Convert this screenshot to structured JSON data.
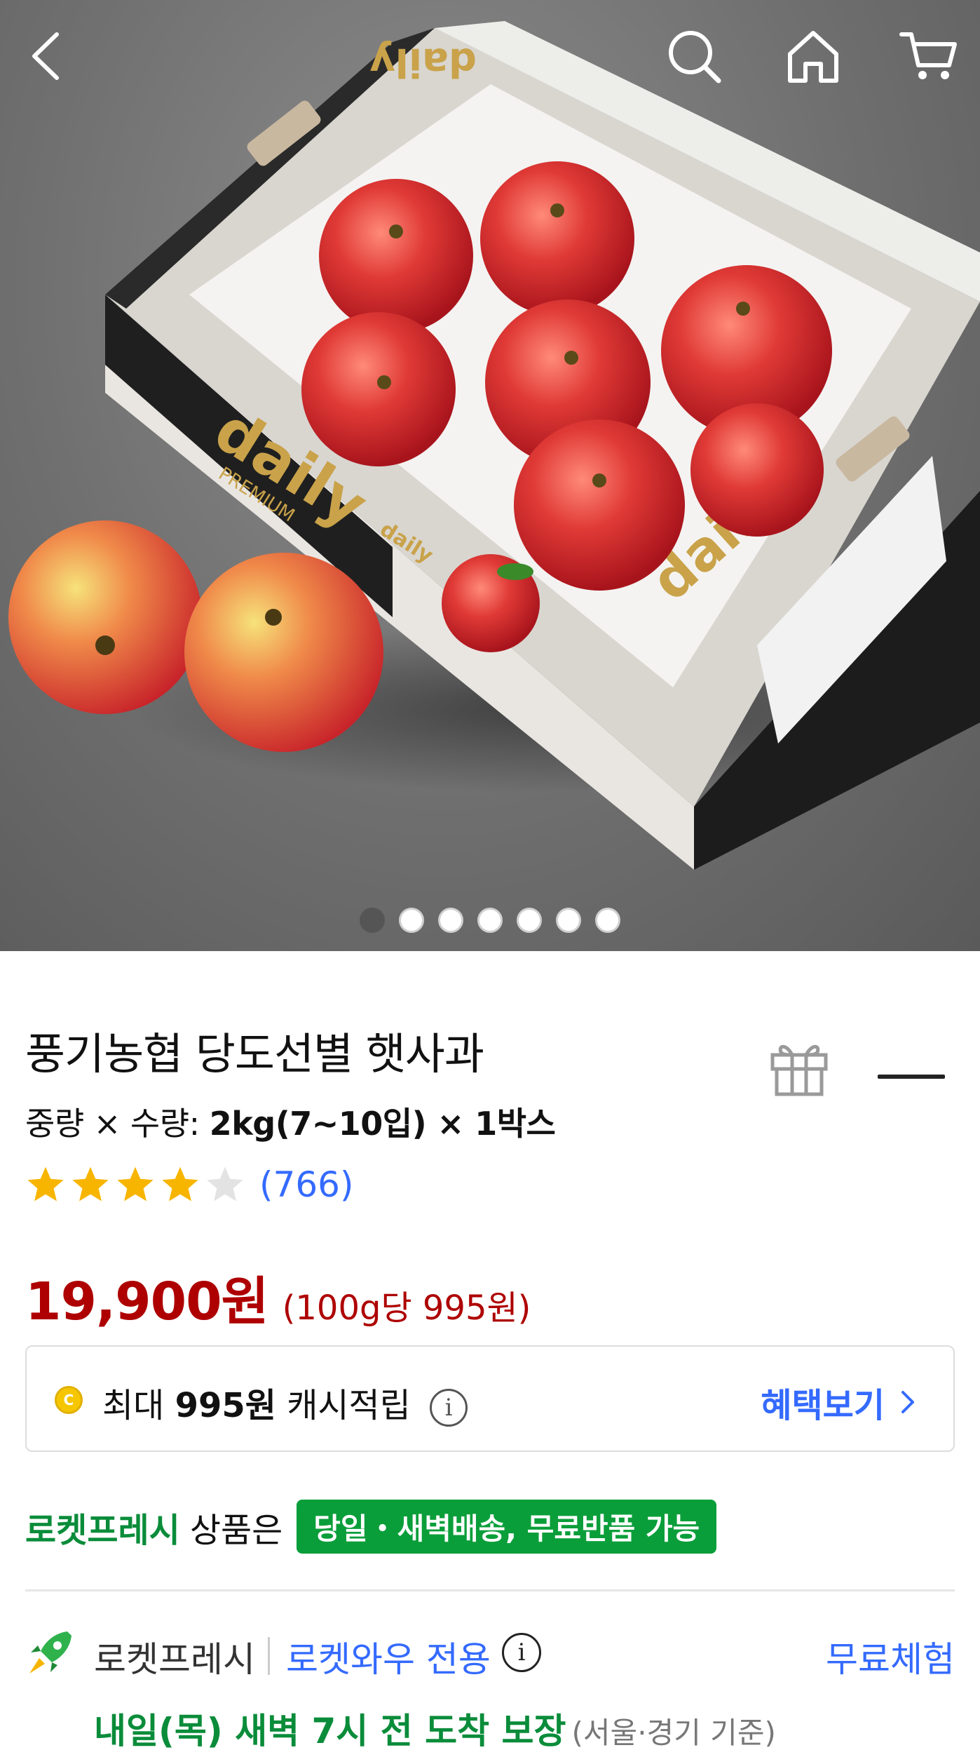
{
  "topbar": {
    "icons": [
      "back-arrow-icon",
      "search-icon",
      "home-icon",
      "cart-icon"
    ]
  },
  "hero": {
    "box_brand": "daily",
    "box_sub": "PREMIUM",
    "image_count": 7,
    "active_index": 0
  },
  "product": {
    "title": "풍기농협 당도선별 햇사과",
    "weight_label": "중량 × 수량: ",
    "weight_value": "2kg(7~10입) × 1박스",
    "rating_stars": 4,
    "review_count": "(766)",
    "price": "19,900원",
    "unit_price": "(100g당 995원)"
  },
  "cashback": {
    "prefix": "최대 ",
    "amount": "995원",
    "suffix": " 캐시적립",
    "info_glyph": "i",
    "benefit_link": "혜택보기",
    "coin_letter": "C"
  },
  "fresh": {
    "brand": "로켓프레시",
    "mid": "상품은",
    "badge": "당일・새벽배송, 무료반품 가능"
  },
  "delivery": {
    "brand": "로켓프레시",
    "wow": "로켓와우 전용",
    "info_glyph": "i",
    "free_trial": "무료체험",
    "arrival": "내일(목) 새벽 7시 전 도착 보장",
    "arrival_note": "(서울·경기 기준)"
  },
  "colors": {
    "price_red": "#ae0000",
    "link_blue": "#346aff",
    "fresh_green": "#0a8c3a",
    "star_yellow": "#f7b500"
  }
}
